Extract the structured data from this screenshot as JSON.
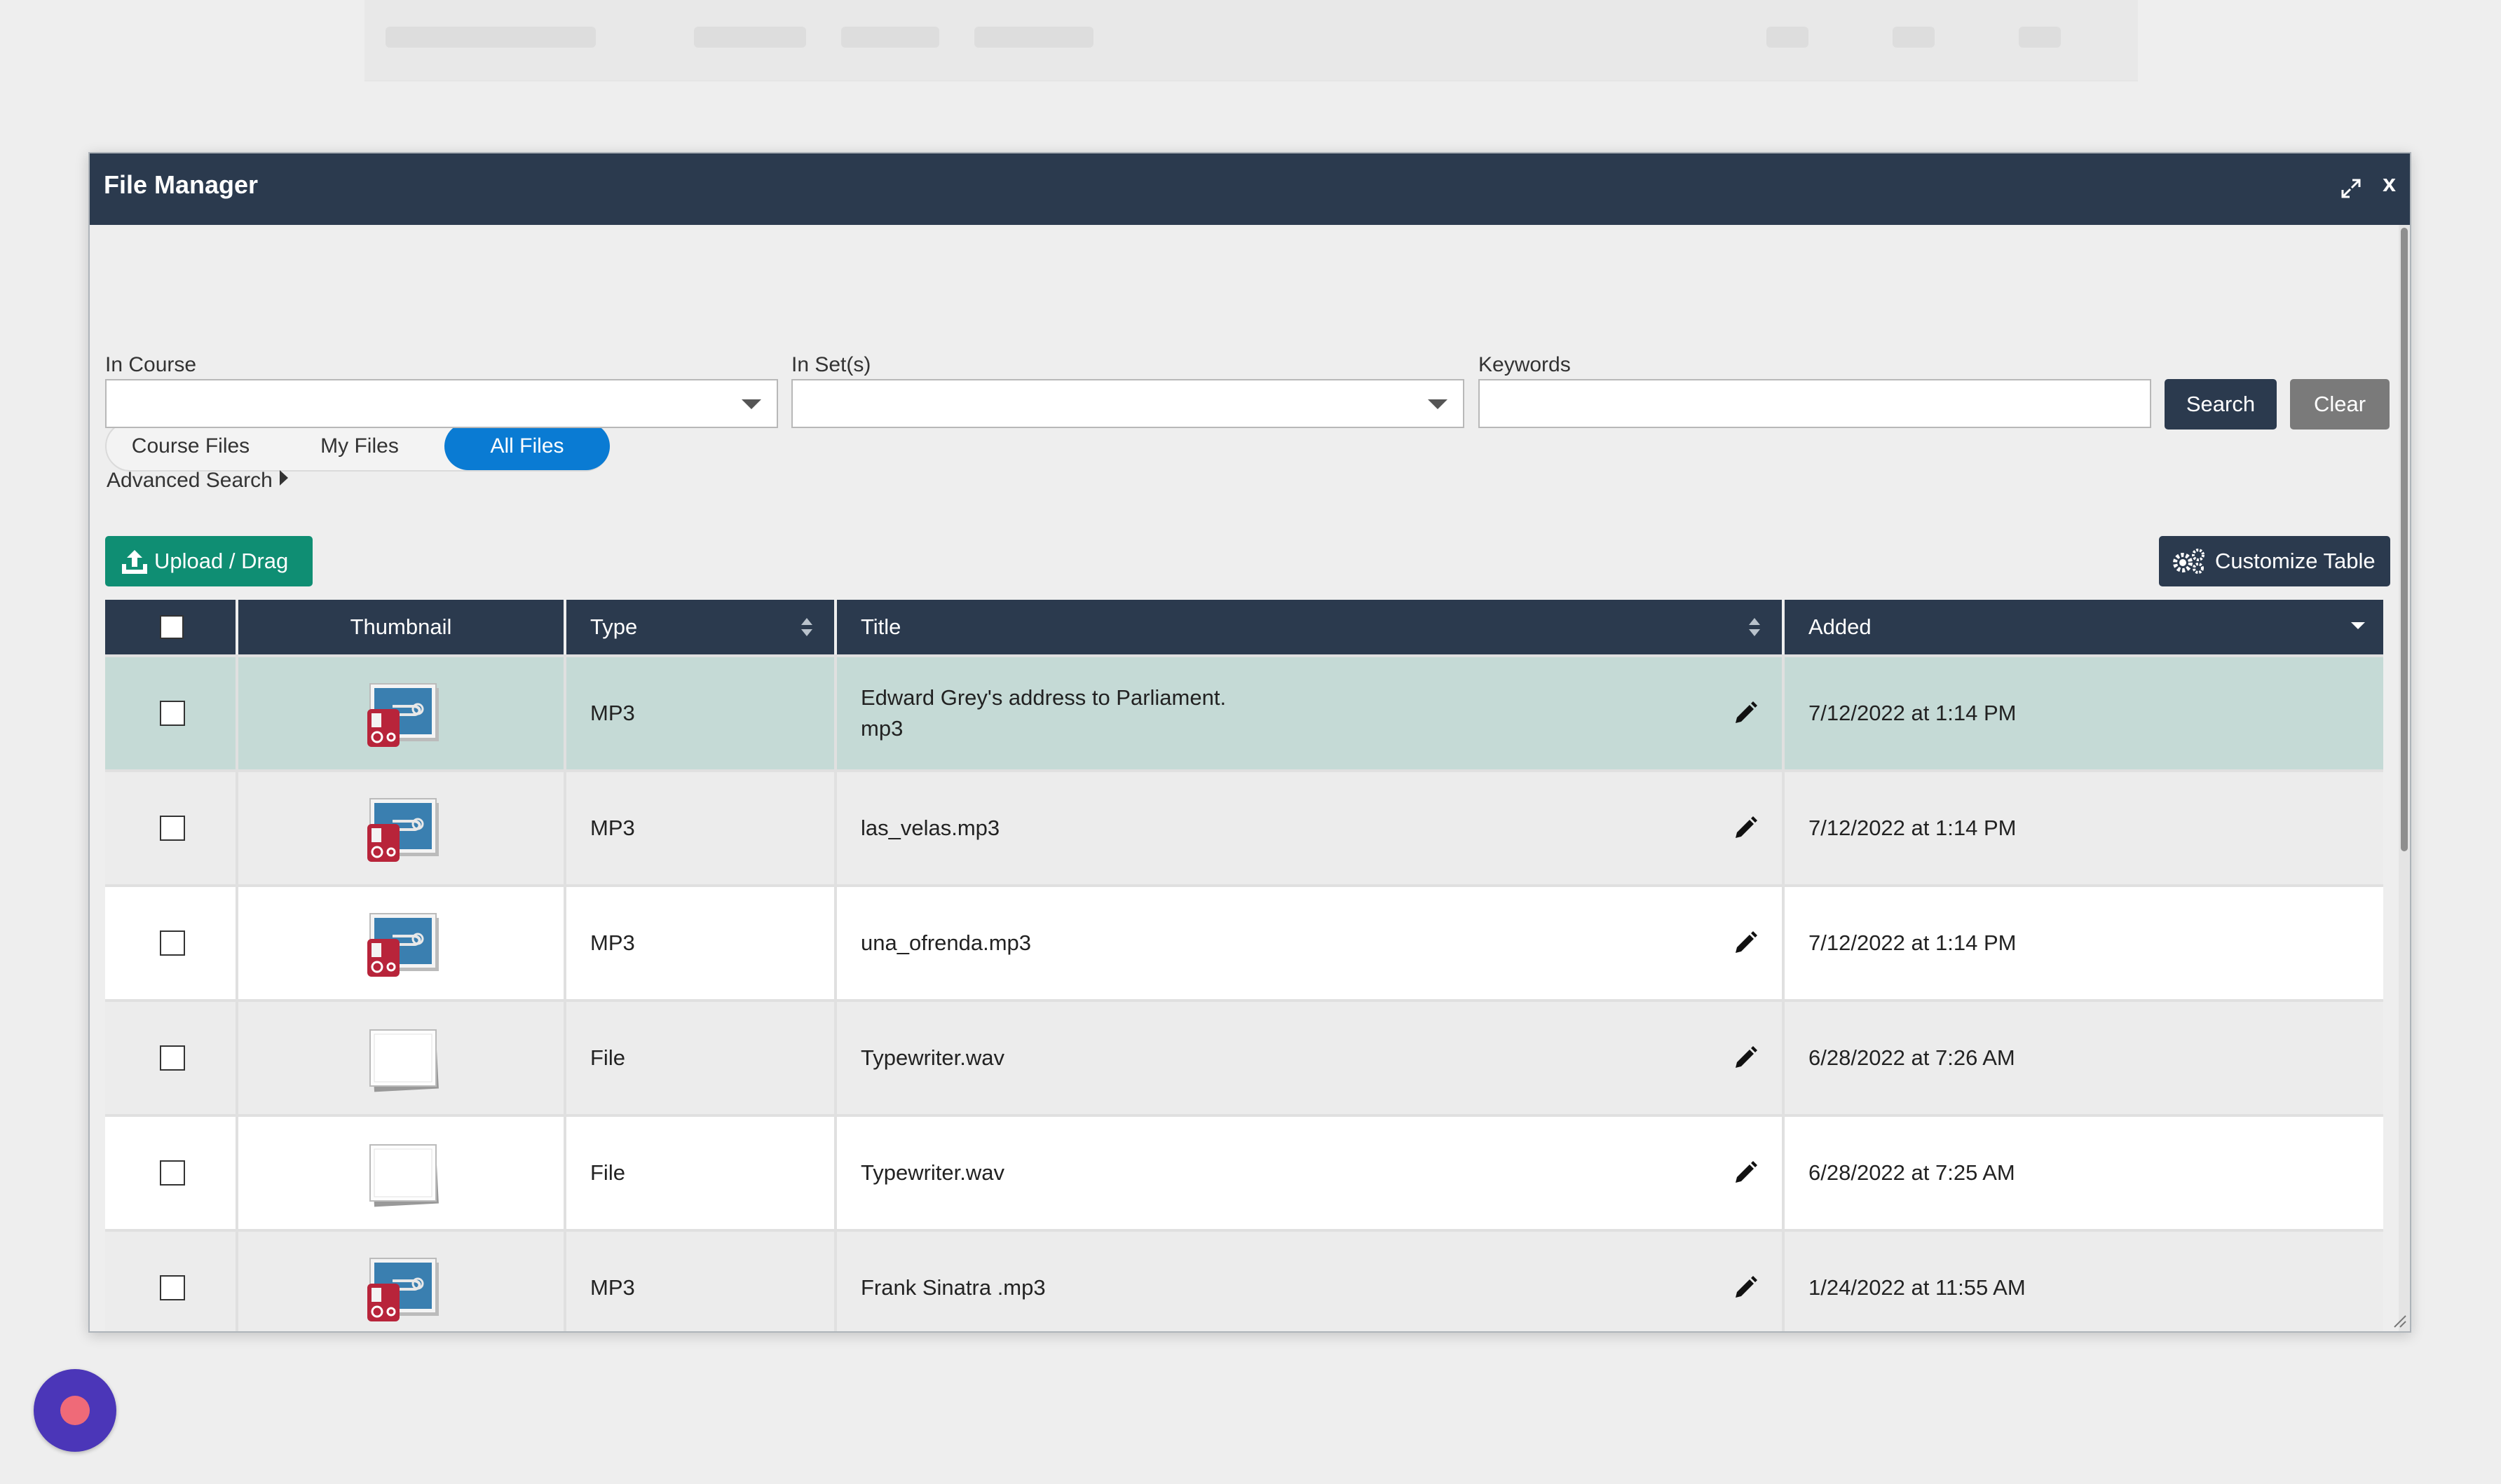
{
  "modal": {
    "title": "File Manager",
    "close_label": "x"
  },
  "tabs": [
    {
      "label": "Course Files",
      "active": false
    },
    {
      "label": "My Files",
      "active": false
    },
    {
      "label": "All Files",
      "active": true
    }
  ],
  "filters": {
    "in_course_label": "In Course",
    "in_course_value": "",
    "in_sets_label": "In Set(s)",
    "in_sets_value": "",
    "keywords_label": "Keywords",
    "keywords_value": "",
    "search_label": "Search",
    "clear_label": "Clear",
    "advanced_search_label": "Advanced Search"
  },
  "toolbar": {
    "upload_label": "Upload / Drag",
    "customize_label": "Customize Table"
  },
  "table": {
    "columns": [
      "Thumbnail",
      "Type",
      "Title",
      "Added"
    ],
    "rows": [
      {
        "type": "MP3",
        "title": "Edward Grey's address to Parliament.",
        "title_line2": "mp3",
        "added": "7/12/2022 at 1:14 PM",
        "thumb": "audio-file-icon",
        "selected": true
      },
      {
        "type": "MP3",
        "title": "las_velas.mp3",
        "title_line2": "",
        "added": "7/12/2022 at 1:14 PM",
        "thumb": "audio-file-icon",
        "selected": false
      },
      {
        "type": "MP3",
        "title": "una_ofrenda.mp3",
        "title_line2": "",
        "added": "7/12/2022 at 1:14 PM",
        "thumb": "audio-file-icon",
        "selected": false
      },
      {
        "type": "File",
        "title": "Typewriter.wav",
        "title_line2": "",
        "added": "6/28/2022 at 7:26 AM",
        "thumb": "generic-file-icon",
        "selected": false
      },
      {
        "type": "File",
        "title": "Typewriter.wav",
        "title_line2": "",
        "added": "6/28/2022 at 7:25 AM",
        "thumb": "generic-file-icon",
        "selected": false
      },
      {
        "type": "MP3",
        "title": "Frank Sinatra .mp3",
        "title_line2": "",
        "added": "1/24/2022 at 11:55 AM",
        "thumb": "audio-file-icon",
        "selected": false
      }
    ]
  },
  "colors": {
    "header_navy": "#2b3a4e",
    "tab_active_blue": "#0a7bd3",
    "upload_green": "#0f8e73",
    "selected_row": "#c5dad6",
    "record_button": "#4b36b8"
  }
}
